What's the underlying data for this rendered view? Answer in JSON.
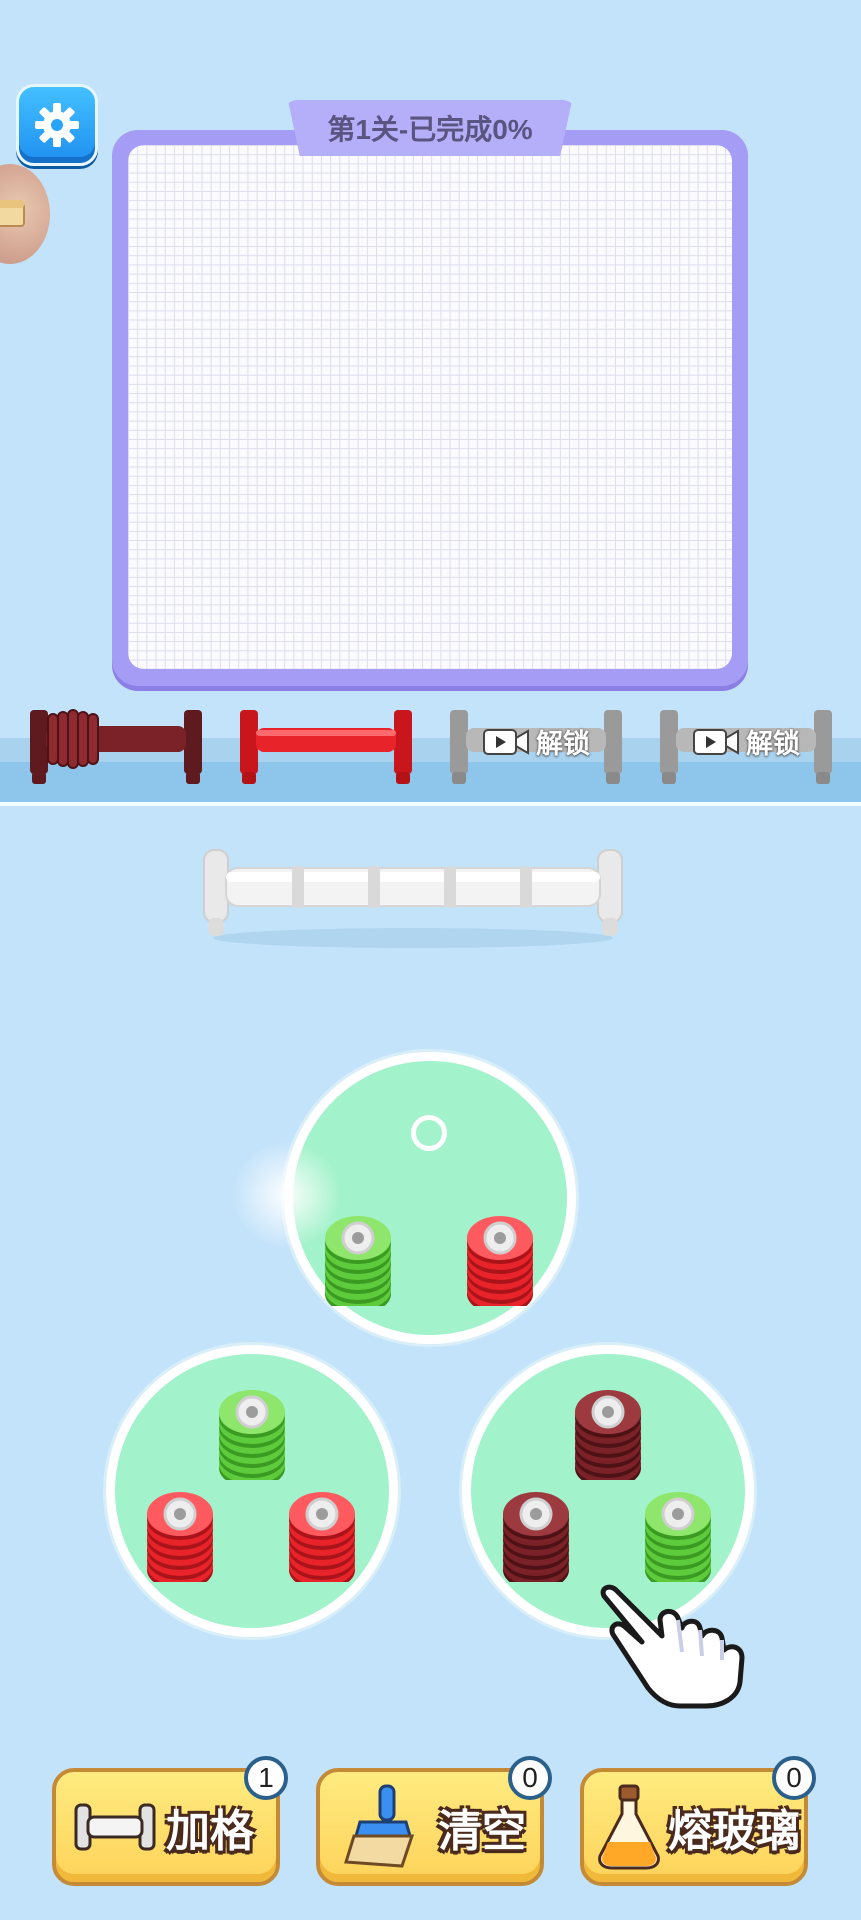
{
  "level": {
    "title": "第1关-已完成0%"
  },
  "shelf": {
    "slots": [
      {
        "color": "#7a2227",
        "state": "filled"
      },
      {
        "color": "#e8232a",
        "state": "empty"
      },
      {
        "label": "解锁",
        "icon": "video-icon",
        "state": "locked"
      },
      {
        "label": "解锁",
        "icon": "video-icon",
        "state": "locked"
      }
    ]
  },
  "trays": [
    {
      "stacks": [
        {
          "color": "green"
        },
        {
          "color": "red"
        }
      ]
    },
    {
      "stacks": [
        {
          "color": "green"
        },
        {
          "color": "red"
        },
        {
          "color": "red"
        }
      ]
    },
    {
      "stacks": [
        {
          "color": "maroon"
        },
        {
          "color": "maroon"
        },
        {
          "color": "green"
        }
      ]
    }
  ],
  "colors": {
    "red": "#e8232a",
    "green": "#5ecb3c",
    "maroon": "#7a2227",
    "tray": "#a2f2cb",
    "board": "#a59cf6"
  },
  "tools": [
    {
      "label": "加格",
      "count": "1",
      "icon": "rod-icon"
    },
    {
      "label": "清空",
      "count": "0",
      "icon": "broom-icon"
    },
    {
      "label": "熔玻璃",
      "count": "0",
      "icon": "potion-icon"
    }
  ]
}
